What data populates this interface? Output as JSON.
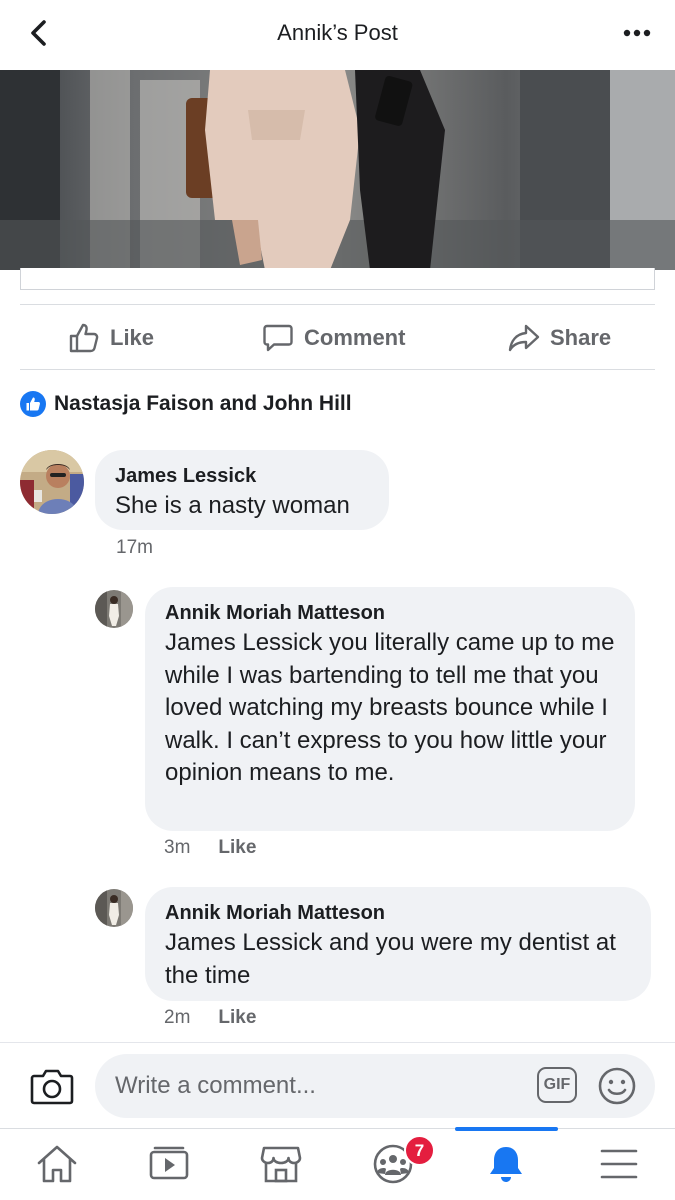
{
  "header": {
    "title": "Annik’s Post"
  },
  "actions": {
    "like": "Like",
    "comment": "Comment",
    "share": "Share"
  },
  "reactions": {
    "names": "Nastasja Faison and John Hill"
  },
  "comments": [
    {
      "author": "James Lessick",
      "text": "She is a nasty woman",
      "time": "17m"
    },
    {
      "author": "Annik Moriah Matteson",
      "text": "James Lessick you literally came up to me while I was bartending to tell me that you loved watching my breasts bounce while I walk. I can’t express to you how little your opinion means to me.",
      "time": "3m",
      "like": "Like"
    },
    {
      "author": "Annik Moriah Matteson",
      "text": "James Lessick and you were my dentist at the time",
      "time": "2m",
      "like": "Like"
    }
  ],
  "composer": {
    "placeholder": "Write a comment...",
    "gif": "GIF"
  },
  "nav": {
    "active": "notifications",
    "groups_badge": "7"
  },
  "colors": {
    "accent": "#1877f2",
    "badge": "#e41e3f",
    "bubble": "#f0f2f5",
    "secondary_text": "#65676b"
  }
}
